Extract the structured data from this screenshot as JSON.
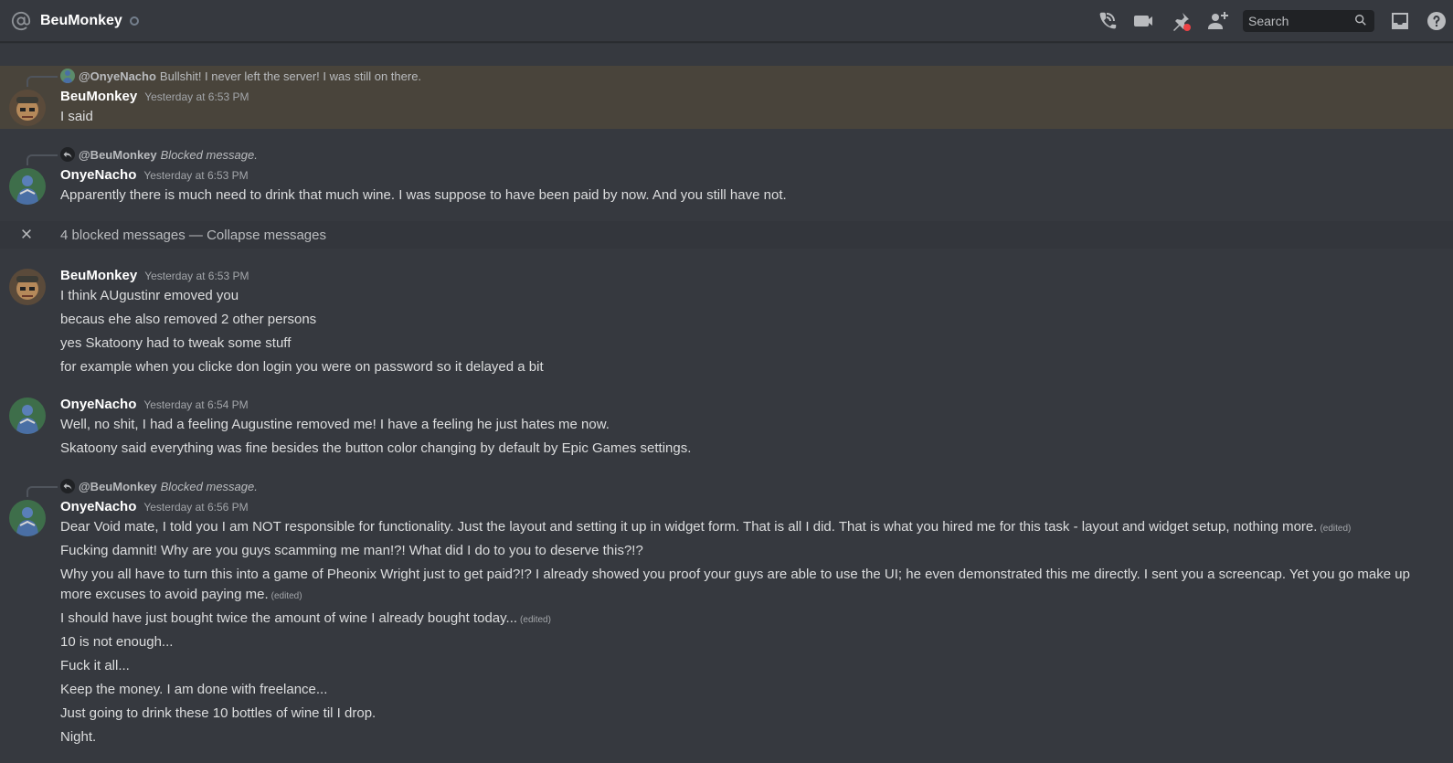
{
  "header": {
    "dm_name": "BeuMonkey",
    "icons": [
      "at-icon",
      "start-voice-call-icon",
      "start-video-call-icon",
      "pinned-messages-icon",
      "add-friends-to-dm-icon",
      "search-icon",
      "inbox-icon",
      "help-icon"
    ],
    "search_placeholder": "Search"
  },
  "messages": [
    {
      "reply": {
        "author": "@OnyeNacho",
        "text": "Bullshit! I never left the server! I was still on there."
      },
      "author": "BeuMonkey",
      "timestamp": "Yesterday at 6:53 PM",
      "lines": [
        {
          "text": "I said"
        }
      ]
    },
    {
      "reply": {
        "author": "@BeuMonkey",
        "text": "Blocked message."
      },
      "author": "OnyeNacho",
      "timestamp": "Yesterday at 6:53 PM",
      "lines": [
        {
          "text": "Apparently there is much need to drink that much wine. I was suppose to have been paid by now. And you still have not."
        }
      ]
    },
    {
      "author": "BeuMonkey",
      "timestamp": "Yesterday at 6:53 PM",
      "lines": [
        {
          "text": "I think AUgustinr emoved you"
        },
        {
          "text": "becaus ehe also removed 2 other persons"
        },
        {
          "text": "yes Skatoony had to tweak some stuff"
        },
        {
          "text": "for example when you clicke don login you were on password so it delayed a bit"
        }
      ]
    },
    {
      "author": "OnyeNacho",
      "timestamp": "Yesterday at 6:54 PM",
      "lines": [
        {
          "text": "Well, no shit, I had a feeling Augustine removed me! I have a feeling he just hates me now."
        },
        {
          "text": "Skatoony said everything was fine besides the button color changing by default by Epic Games settings."
        }
      ]
    },
    {
      "reply": {
        "author": "@BeuMonkey",
        "text": "Blocked message."
      },
      "author": "OnyeNacho",
      "timestamp": "Yesterday at 6:56 PM",
      "lines": [
        {
          "text": "Dear Void mate, I told you I am NOT responsible for functionality. Just the layout and setting it up in widget form. That is all I did. That is what you hired me for this task - layout and widget setup, nothing more.",
          "edited": "(edited)"
        },
        {
          "text": "Fucking damnit! Why are you guys scamming me man!?! What did I do to you to deserve this?!?"
        },
        {
          "text": "Why you all have to turn this into a game of Pheonix Wright just to get paid?!? I already showed you proof your guys are able to use the UI; he even demonstrated this me directly. I sent you a screencap. Yet you go make up more excuses to avoid paying me.",
          "edited": "(edited)"
        },
        {
          "text": "I should have just bought twice the amount of wine I already bought today...",
          "edited": "(edited)"
        },
        {
          "text": "10 is not enough..."
        },
        {
          "text": "Fuck it all..."
        },
        {
          "text": "Keep the money. I am done with freelance..."
        },
        {
          "text": "Just going to drink these 10 bottles of wine til I drop."
        },
        {
          "text": "Night."
        }
      ]
    }
  ],
  "blocked_bar": {
    "count_text": "4 blocked messages",
    "separator": " — ",
    "action": "Collapse messages"
  },
  "colors": {
    "background": "#36393f",
    "highlight": "#faa81a",
    "text": "#dcddde",
    "author": "#ffffff",
    "muted": "#a3a6aa"
  }
}
